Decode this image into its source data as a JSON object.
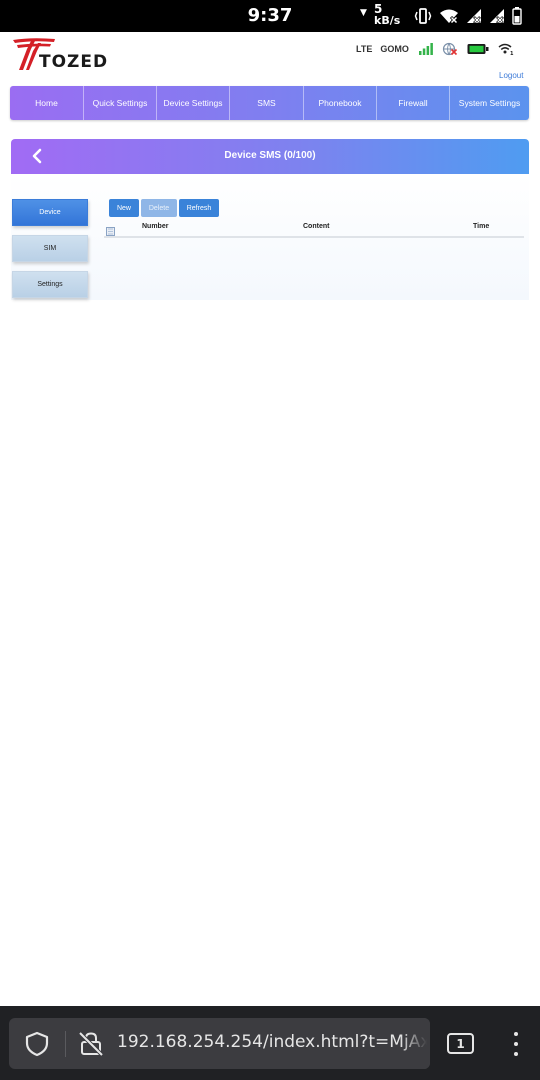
{
  "status_bar": {
    "time": "9:37",
    "net_speed_value": "5",
    "net_speed_unit": "kB/s"
  },
  "router": {
    "brand": "TOZED",
    "network_type": "LTE",
    "carrier": "GOMO",
    "logout_label": "Logout"
  },
  "nav": {
    "items": [
      {
        "label": "Home"
      },
      {
        "label": "Quick Settings"
      },
      {
        "label": "Device Settings"
      },
      {
        "label": "SMS"
      },
      {
        "label": "Phonebook"
      },
      {
        "label": "Firewall"
      },
      {
        "label": "System Settings"
      }
    ]
  },
  "page": {
    "title": "Device SMS (0/100)"
  },
  "side_menu": {
    "items": [
      {
        "label": "Device",
        "active": true
      },
      {
        "label": "SIM",
        "active": false
      },
      {
        "label": "Settings",
        "active": false
      }
    ]
  },
  "toolbar": {
    "new_label": "New",
    "delete_label": "Delete",
    "refresh_label": "Refresh"
  },
  "table": {
    "columns": [
      "Number",
      "Content",
      "Time"
    ],
    "rows": []
  },
  "browser": {
    "url": "192.168.254.254/index.html?t=MjAx",
    "tab_count": "1"
  },
  "colors": {
    "nav_gradient_start": "#9a6df2",
    "nav_gradient_end": "#5b93ee",
    "active_button": "#3a83d9",
    "brand_red": "#d42027"
  }
}
